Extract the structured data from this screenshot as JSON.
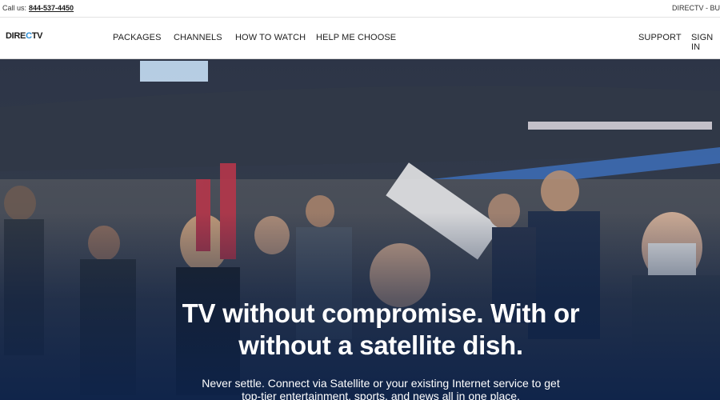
{
  "utility": {
    "call_label": "Call us:",
    "phone": "844-537-4450",
    "right_text": "DIRECTV - BU"
  },
  "brand": {
    "logo_prefix": "DIRE",
    "logo_c": "C",
    "logo_suffix": "TV",
    "accent_color": "#2a8ed6"
  },
  "nav": {
    "items": [
      {
        "label": "PACKAGES"
      },
      {
        "label": "CHANNELS"
      },
      {
        "label": "HOW TO WATCH"
      },
      {
        "label": "HELP ME CHOOSE"
      }
    ],
    "support": "SUPPORT",
    "sign_in": "SIGN IN"
  },
  "hero": {
    "headline": "TV without compromise. With or without a satellite dish.",
    "subhead": "Never settle. Connect via Satellite or your existing Internet service to get top-tier entertainment, sports, and news all in one place.",
    "overlay_color": "#0c224a"
  }
}
